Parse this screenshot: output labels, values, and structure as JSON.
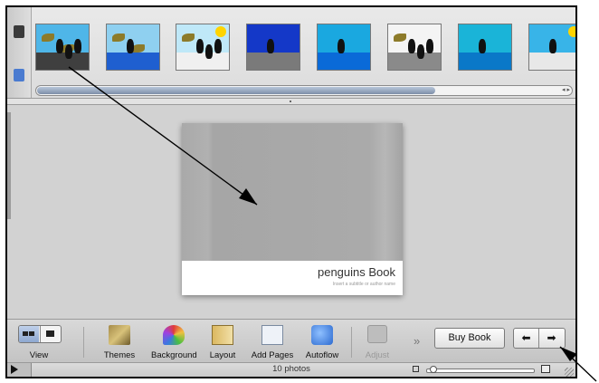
{
  "photo_strip": {
    "thumbnails": [
      {
        "sky": "#4fb6e8",
        "ground": "#3f3f3f",
        "birds": 2,
        "penguins": 3,
        "sun": false
      },
      {
        "sky": "#8fd0f0",
        "ground": "#1f5fd0",
        "birds": 2,
        "penguins": 1,
        "sun": false
      },
      {
        "sky": "#bfe8f8",
        "ground": "#f0f0f0",
        "birds": 1,
        "penguins": 3,
        "sun": true
      },
      {
        "sky": "#1438c8",
        "ground": "#7a7a7a",
        "birds": 0,
        "penguins": 1,
        "sun": false
      },
      {
        "sky": "#1aa8e0",
        "ground": "#0a6ad8",
        "birds": 0,
        "penguins": 1,
        "sun": false
      },
      {
        "sky": "#f4f4f4",
        "ground": "#8a8a8a",
        "birds": 1,
        "penguins": 3,
        "sun": false
      },
      {
        "sky": "#1ab4d8",
        "ground": "#0a78c8",
        "birds": 0,
        "penguins": 1,
        "sun": false
      },
      {
        "sky": "#38b4e8",
        "ground": "#e8e8e8",
        "birds": 0,
        "penguins": 1,
        "sun": true
      }
    ],
    "scroll_arrows": "◂ ▸"
  },
  "book": {
    "title": "penguins Book",
    "subtitle": "Insert a subtitle or author name"
  },
  "toolbar": {
    "view_label": "View",
    "themes_label": "Themes",
    "background_label": "Background",
    "layout_label": "Layout",
    "add_pages_label": "Add Pages",
    "autoflow_label": "Autoflow",
    "adjust_label": "Adjust",
    "more": "»",
    "buy_book_label": "Buy Book",
    "prev_arrow": "⬅",
    "next_arrow": "➡"
  },
  "status": {
    "photo_count": "10 photos"
  },
  "icons": {
    "pages": "pages-icon",
    "layers": "layers-icon",
    "themes": "themes-icon",
    "background": "background-icon",
    "layout": "layout-icon",
    "add_pages": "add-pages-icon",
    "autoflow": "autoflow-icon",
    "adjust": "adjust-icon",
    "play": "play-icon",
    "zoom_small": "zoom-small-icon",
    "zoom_large": "zoom-large-icon"
  },
  "zoom": {
    "level": 0.05
  },
  "colors": {
    "accent": "#8ea8d0",
    "annotation_arrow": "#000000"
  }
}
